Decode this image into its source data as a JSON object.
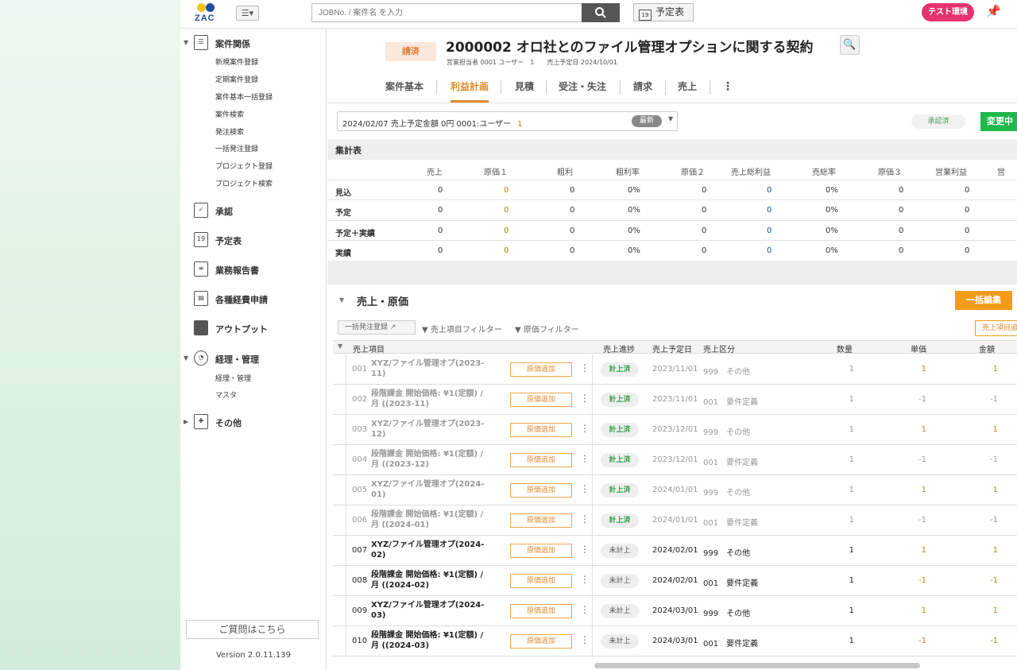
{
  "topbar": {
    "logo_text": "ZAC",
    "search_placeholder": "JOBNo. / 案件名 を入力",
    "schedule_label": "予定表",
    "schedule_icon_text": "19",
    "test_badge": "テスト環境"
  },
  "sidebar": {
    "sections": [
      {
        "label": "案件関係",
        "icon": "list-icon"
      },
      {
        "label": "承認",
        "icon": "checkbox-icon"
      },
      {
        "label": "予定表",
        "icon": "calendar-icon",
        "icon_text": "19"
      },
      {
        "label": "業務報告書",
        "icon": "report-icon"
      },
      {
        "label": "各種経費申請",
        "icon": "expense-icon"
      },
      {
        "label": "アウトプット",
        "icon": "folder-icon"
      },
      {
        "label": "経理・管理",
        "icon": "pie-chart-icon"
      },
      {
        "label": "その他",
        "icon": "plus-grid-icon"
      }
    ],
    "case_items": [
      "新規案件登録",
      "定期案件登録",
      "案件基本一括登録",
      "案件検索",
      "発注検索",
      "一括発注登録",
      "プロジェクト登録",
      "プロジェクト検索"
    ],
    "acct_items": [
      "経理・管理",
      "マスタ"
    ],
    "help_label": "ご質問はこちら",
    "version": "Version 2.0.11.139"
  },
  "header": {
    "status_badge": "請済",
    "title": "2000002 オロ社とのファイル管理オプションに関する契約",
    "meta": "営業担当者 0001 ユーザー　1　　売上予定日 2024/10/01"
  },
  "tabs": [
    {
      "label": "案件基本",
      "active": false
    },
    {
      "label": "利益計画",
      "active": true
    },
    {
      "label": "見積",
      "active": false
    },
    {
      "label": "受注・失注",
      "active": false
    },
    {
      "label": "請求",
      "active": false
    },
    {
      "label": "売上",
      "active": false
    }
  ],
  "plan_selector": {
    "text": "2024/02/07 売上予定金額 0円 0001:ユーザー",
    "num": "1",
    "latest_badge": "最新"
  },
  "approval_status": "承認済",
  "change_button": "変更中",
  "summary": {
    "title": "集計表",
    "columns": [
      "売上",
      "原価１",
      "粗利",
      "粗利率",
      "原価２",
      "売上総利益",
      "売総率",
      "原価３",
      "営業利益",
      "営"
    ],
    "rows": [
      {
        "label": "見込",
        "values": [
          "0",
          "0",
          "0",
          "0%",
          "0",
          "0",
          "0%",
          "0",
          "0"
        ]
      },
      {
        "label": "予定",
        "values": [
          "0",
          "0",
          "0",
          "0%",
          "0",
          "0",
          "0%",
          "0",
          "0"
        ]
      },
      {
        "label": "予定＋実績",
        "values": [
          "0",
          "0",
          "0",
          "0%",
          "0",
          "0",
          "0%",
          "0",
          "0"
        ]
      },
      {
        "label": "実績",
        "values": [
          "0",
          "0",
          "0",
          "0%",
          "0",
          "0",
          "0%",
          "0",
          "0"
        ]
      }
    ]
  },
  "sales": {
    "title": "売上・原価",
    "bulk_edit": "一括編集",
    "bulk_order": "一括発注登録",
    "filter_sales": "売上項目フィルター",
    "filter_cost": "原価フィルター",
    "sales_item_btn": "売上項目追加",
    "columns": {
      "item": "売上項目",
      "progress": "売上進捗",
      "date": "売上予定日",
      "kbn": "売上区分",
      "qty": "数量",
      "price": "単価",
      "amount": "金額"
    },
    "cost_add_label": "原価追加",
    "rows": [
      {
        "no": "001",
        "name": "XYZ/ファイル管理オプ(2023-11)",
        "progress": "計上済",
        "date": "2023/11/01",
        "kbn": "999　その他",
        "qty": "1",
        "price": "1",
        "amount": "1"
      },
      {
        "no": "002",
        "name": "段階課金 開始価格: ¥1(定額) / 月 ((2023-11)",
        "progress": "計上済",
        "date": "2023/11/01",
        "kbn": "001　要件定義",
        "qty": "1",
        "price": "-1",
        "amount": "-1"
      },
      {
        "no": "003",
        "name": "XYZ/ファイル管理オプ(2023-12)",
        "progress": "計上済",
        "date": "2023/12/01",
        "kbn": "999　その他",
        "qty": "1",
        "price": "1",
        "amount": "1"
      },
      {
        "no": "004",
        "name": "段階課金 開始価格: ¥1(定額) / 月 ((2023-12)",
        "progress": "計上済",
        "date": "2023/12/01",
        "kbn": "001　要件定義",
        "qty": "1",
        "price": "-1",
        "amount": "-1"
      },
      {
        "no": "005",
        "name": "XYZ/ファイル管理オプ(2024-01)",
        "progress": "計上済",
        "date": "2024/01/01",
        "kbn": "999　その他",
        "qty": "1",
        "price": "1",
        "amount": "1"
      },
      {
        "no": "006",
        "name": "段階課金 開始価格: ¥1(定額) / 月 ((2024-01)",
        "progress": "計上済",
        "date": "2024/01/01",
        "kbn": "001　要件定義",
        "qty": "1",
        "price": "-1",
        "amount": "-1"
      },
      {
        "no": "007",
        "name": "XYZ/ファイル管理オプ(2024-02)",
        "progress": "未計上",
        "date": "2024/02/01",
        "kbn": "999　その他",
        "qty": "1",
        "price": "1",
        "amount": "1"
      },
      {
        "no": "008",
        "name": "段階課金 開始価格: ¥1(定額) / 月 ((2024-02)",
        "progress": "未計上",
        "date": "2024/02/01",
        "kbn": "001　要件定義",
        "qty": "1",
        "price": "-1",
        "amount": "-1"
      },
      {
        "no": "009",
        "name": "XYZ/ファイル管理オプ(2024-03)",
        "progress": "未計上",
        "date": "2024/03/01",
        "kbn": "999　その他",
        "qty": "1",
        "price": "1",
        "amount": "1"
      },
      {
        "no": "010",
        "name": "段階課金 開始価格: ¥1(定額) / 月 ((2024-03)",
        "progress": "未計上",
        "date": "2024/03/01",
        "kbn": "001　要件定義",
        "qty": "1",
        "price": "-1",
        "amount": "-1"
      }
    ]
  },
  "colors": {
    "accent": "#e08a2c",
    "primary_button": "#f39b1a",
    "success": "#1fb84a",
    "test_badge": "#e6336e"
  }
}
